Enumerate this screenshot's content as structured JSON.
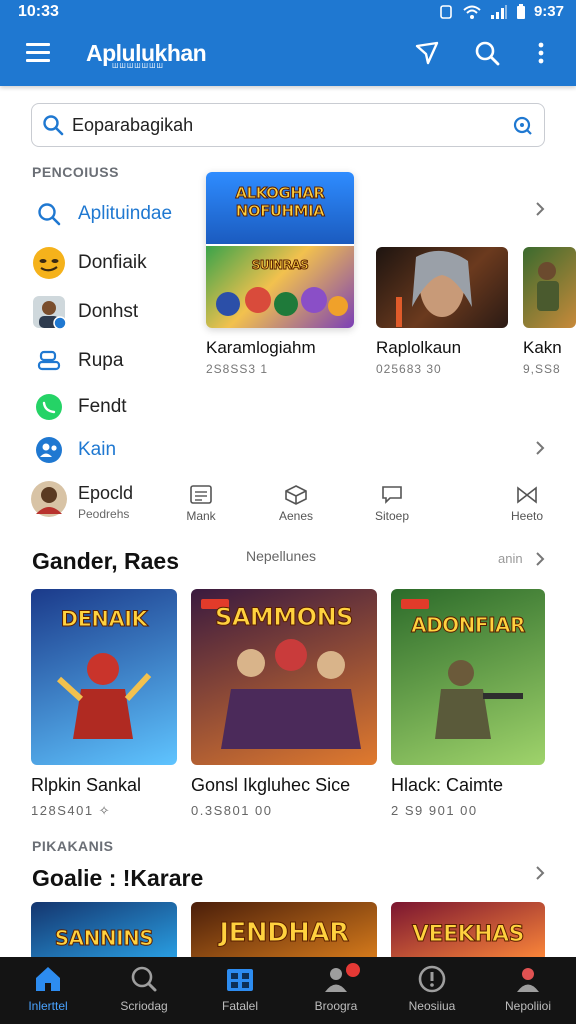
{
  "status": {
    "time": "10:33",
    "clock_right": "9:37"
  },
  "app": {
    "title": "Aplulukhan",
    "subtitle": "ШШШШШШШ"
  },
  "search": {
    "value": "Eoparabagikah",
    "placeholder": ""
  },
  "left_list": {
    "caption": "PENCOIUSS",
    "items": [
      {
        "label": "Aplituindae",
        "icon": "search-icon",
        "highlight": true
      },
      {
        "label": "Donfiaik",
        "icon": "smiley-avatar-icon",
        "highlight": false
      },
      {
        "label": "Donhst",
        "icon": "user-avatar-icon",
        "highlight": false
      },
      {
        "label": "Rupa",
        "icon": "bed-icon",
        "highlight": false
      },
      {
        "label": "Fendt",
        "icon": "whatsapp-icon",
        "highlight": false
      },
      {
        "label": "Kain",
        "icon": "people-icon",
        "highlight": true
      }
    ]
  },
  "quick_row": {
    "profile_title": "Epocld",
    "profile_sub": "Peodrehs",
    "tiles": [
      {
        "label": "Mank",
        "icon": "calendar-grid-icon"
      },
      {
        "label": "Aenes",
        "icon": "box-icon"
      },
      {
        "label": "Sitoep",
        "icon": "chat-icon"
      },
      {
        "label": "Heeto",
        "icon": "bow-tie-icon"
      }
    ]
  },
  "featured": {
    "banner_text": "ALKOGHAR NOFUHMIA",
    "cards": [
      {
        "title": "Karamlogiahm",
        "meta": "2S8SS3 1",
        "art": "SUINRAS"
      },
      {
        "title": "Raplolkaun",
        "meta": "025683 30",
        "art": ""
      },
      {
        "title": "Kakn",
        "meta": "9,SS8",
        "art": ""
      }
    ]
  },
  "section1": {
    "title": "Gander, Raes",
    "mid_label": "Nepellunes",
    "more_label": "anin",
    "games": [
      {
        "name": "Rlpkin Sankal",
        "meta": "128S401 ✧",
        "art": "DENAIK",
        "bg1": "#1b3a8a",
        "bg2": "#5fc4ff"
      },
      {
        "name": "Gonsl Ikgluhec Sice",
        "meta": "0.3S801 00",
        "art": "SAMMONS",
        "bg1": "#3a1a3f",
        "bg2": "#e07a2e"
      },
      {
        "name": "Hlack: Caimte",
        "meta": "2 S9 901 00",
        "art": "ADONFIAR",
        "bg1": "#2c6b2a",
        "bg2": "#9fd36b"
      }
    ]
  },
  "section2": {
    "caption": "PIKAKANIS",
    "title": "Goalie : !Karare",
    "games": [
      {
        "art": "SANNINS",
        "bg1": "#14356e",
        "bg2": "#2aa2e6"
      },
      {
        "art": "JENDHAR",
        "bg1": "#4a1e0a",
        "bg2": "#d97d1c"
      },
      {
        "art": "VEEKHAS",
        "bg1": "#7a1530",
        "bg2": "#ff8a3a"
      }
    ]
  },
  "bottom_nav": [
    {
      "label": "Inlerttel",
      "icon": "home-icon",
      "active": true
    },
    {
      "label": "Scriodag",
      "icon": "search-icon",
      "active": false
    },
    {
      "label": "Fatalel",
      "icon": "apps-icon",
      "active": false
    },
    {
      "label": "Broogra",
      "icon": "user-icon",
      "active": false,
      "badge": true
    },
    {
      "label": "Neosiiua",
      "icon": "info-icon",
      "active": false
    },
    {
      "label": "Nepoliioi",
      "icon": "account-icon",
      "active": false
    }
  ],
  "colors": {
    "accent": "#1f78d1",
    "nav_bg": "#141414",
    "nav_active": "#4aa3ff",
    "badge": "#e53935"
  }
}
